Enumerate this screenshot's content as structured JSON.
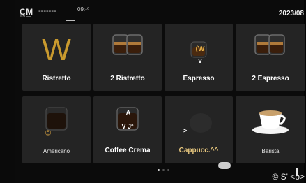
{
  "status": {
    "left_text": "CM",
    "dashes": "-------",
    "time": "09:¹⁰",
    "sub_text": "IN —",
    "date": "2023/08"
  },
  "drinks_row1": [
    {
      "label": "Ristretto",
      "icon": "w-logo-icon"
    },
    {
      "label": "2 Ristretto",
      "icon": "double-espresso-glass-icon"
    },
    {
      "label": "Espresso",
      "icon": "espresso-glass-icon",
      "overlay_top": "(W",
      "overlay_bottom": "v"
    },
    {
      "label": "2 Espresso",
      "icon": "double-espresso-glass-icon"
    }
  ],
  "drinks_row2": [
    {
      "label": "Americano",
      "icon": "americano-glass-icon",
      "overlay": "©"
    },
    {
      "label": "Coffee Crema",
      "icon": "crema-glass-icon",
      "overlay_top": "A",
      "overlay_bottom": "V J°"
    },
    {
      "label": "Cappucc.^^",
      "icon": "cappuccino-icon",
      "overlay": ">"
    },
    {
      "label": "Barista",
      "icon": "white-cup-icon"
    }
  ],
  "pagination": {
    "pages": 3,
    "active": 1
  },
  "footer_text": "© S' <o>",
  "colors": {
    "background": "#0b0b0b",
    "tile": "#242424",
    "accent_gold": "#c99a2e",
    "label": "#ffffff"
  }
}
